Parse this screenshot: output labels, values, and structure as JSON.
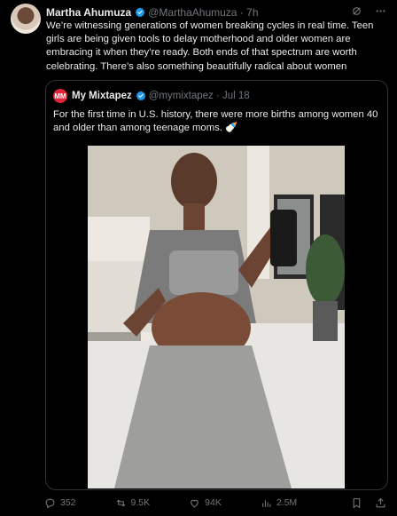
{
  "author": {
    "name": "Martha Ahumuza",
    "handle": "@MarthaAhumuza",
    "time": "7h",
    "text": "We’re witnessing generations of women breaking cycles in real time. Teen girls are being given tools to delay motherhood and older women are embracing it when they’re ready. Both ends of that spectrum are worth celebrating. There’s also something beautifully radical about women"
  },
  "quote": {
    "logo_text": "MM",
    "name": "My Mixtapez",
    "handle": "@mymixtapez",
    "date": "Jul 18",
    "text": "For the first time in U.S. history, there were more births among women 40 and older than among teenage moms. 🍼"
  },
  "actions": {
    "replies": "352",
    "reposts": "9.5K",
    "likes": "94K",
    "views": "2.5M"
  },
  "colors": {
    "verified": "#1d9bf0",
    "logo": "#e0243a"
  }
}
